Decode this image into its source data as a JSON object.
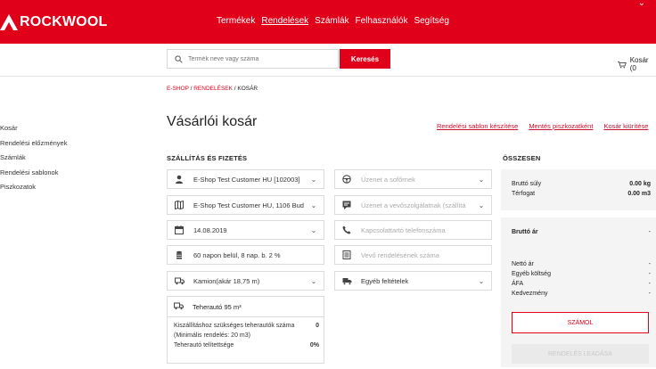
{
  "brand": {
    "name": "ROCKWOOL",
    "color": "#e1001a"
  },
  "nav": [
    {
      "label": "Termékek",
      "active": false
    },
    {
      "label": "Rendelések",
      "active": true
    },
    {
      "label": "Számlák",
      "active": false
    },
    {
      "label": "Felhasználók",
      "active": false
    },
    {
      "label": "Segítség",
      "active": false
    }
  ],
  "search": {
    "placeholder": "Termék neve vagy száma",
    "button": "Keresés"
  },
  "cart": {
    "label": "Kosár (0"
  },
  "sidebar": {
    "items": [
      "Kosár",
      "Rendelési előzmények",
      "Számlák",
      "Rendelési sablonok",
      "Piszkozatok"
    ]
  },
  "breadcrumb": {
    "part1": "E-SHOP",
    "sep1": " / ",
    "part2": "RENDELÉSEK",
    "sep2": " / ",
    "part3": "KOSÁR"
  },
  "page": {
    "title": "Vásárlói kosár",
    "actions": [
      "Rendelési sablon készítése",
      "Mentés piszkozatként",
      "Kosár kiürítése"
    ]
  },
  "shipping": {
    "title": "SZÁLLÍTÁS ÉS FIZETÉS",
    "left": [
      {
        "icon": "person-icon",
        "value": "E-Shop Test Customer HU [102003]",
        "dropdown": true
      },
      {
        "icon": "map-icon",
        "value": "E-Shop Test Customer HU, 1106 Bud",
        "dropdown": true
      },
      {
        "icon": "calendar-icon",
        "value": "14.08.2019",
        "dropdown": true
      },
      {
        "icon": "coins-icon",
        "value": "60 napon belül, 8 nap. b. 2 %",
        "dropdown": false
      },
      {
        "icon": "truck-icon",
        "value": "Kamion(akár 18,75 m)",
        "dropdown": true
      },
      {
        "icon": "truck-icon",
        "value": "Teherautó 95 m³",
        "dropdown": false
      }
    ],
    "right": [
      {
        "icon": "steering-wheel-icon",
        "placeholder": "Üzenet a sofőrnek",
        "dropdown": true
      },
      {
        "icon": "support-icon",
        "placeholder": "Üzenet a vevőszolgálatnak (szállítá",
        "dropdown": true
      },
      {
        "icon": "phone-icon",
        "placeholder": "Kapcsolattartó telefonszáma",
        "dropdown": false
      },
      {
        "icon": "document-icon",
        "placeholder": "Vevő rendelésének száma",
        "dropdown": false
      },
      {
        "icon": "truck-icon",
        "value": "Egyéb feltételek",
        "dropdown": true
      }
    ],
    "capacity": {
      "line1_label": "Kiszállításhoz szükséges teherautók száma",
      "line1_value": "0",
      "line2_label": "(Minimális rendelés: 20 m3)",
      "line3_label": "Teherautó telítettsége",
      "line3_value": "0%"
    }
  },
  "summary": {
    "title": "ÖSSZESEN",
    "gross_weight_label": "Bruttó súly",
    "gross_weight_value": "0.00 kg",
    "volume_label": "Térfogat",
    "volume_value": "0.00 m3",
    "gross_price_label": "Bruttó ár",
    "gross_price_value": "-",
    "net_price_label": "Nettó ár",
    "net_price_value": "-",
    "other_cost_label": "Egyéb költség",
    "other_cost_value": "-",
    "vat_label": "ÁFA",
    "vat_value": "-",
    "discount_label": "Kedvezmény",
    "discount_value": "-",
    "calc_button": "SZÁMOL",
    "checkout_button": "RENDELÉS LEADÁSA"
  }
}
